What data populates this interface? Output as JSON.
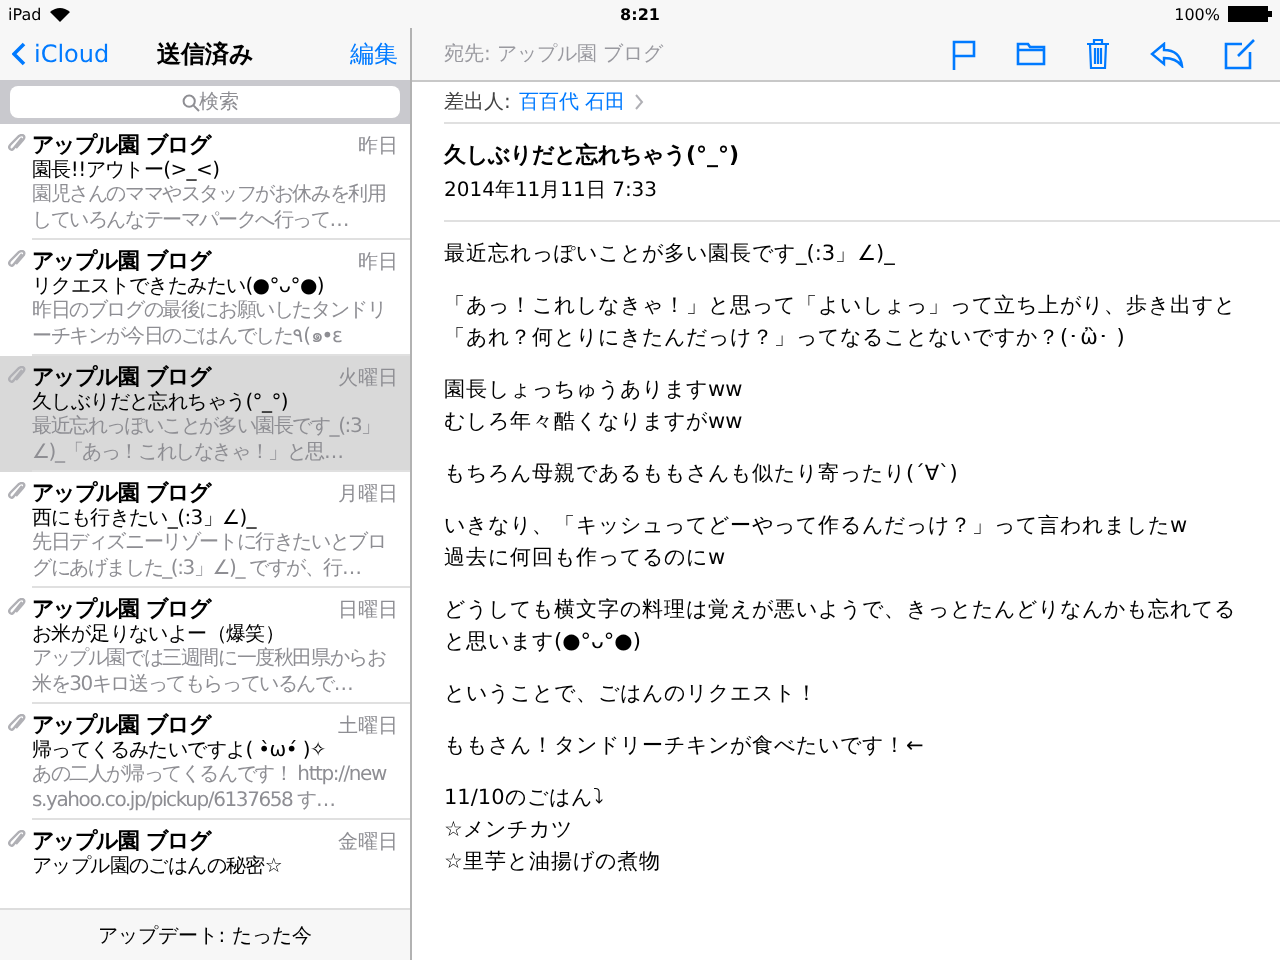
{
  "status_bar": {
    "device": "iPad",
    "time": "8:21",
    "battery": "100%"
  },
  "sidebar": {
    "back": "iCloud",
    "title": "送信済み",
    "edit": "編集",
    "search": {
      "placeholder": "検索"
    },
    "messages": [
      {
        "sender": "アップル園 ブログ",
        "date": "昨日",
        "subject": "園長!!アウトー(>_<)",
        "preview": "園児さんのママやスタッフがお休みを利用していろんなテーマパークへ行って…",
        "attachment": true,
        "selected": false
      },
      {
        "sender": "アップル園 ブログ",
        "date": "昨日",
        "subject": "リクエストできたみたい(●°ᴗ°●)",
        "preview": "昨日のブログの最後にお願いしたタンドリーチキンが今日のごはんでした٩(๑•ε",
        "attachment": true,
        "selected": false
      },
      {
        "sender": "アップル園 ブログ",
        "date": "火曜日",
        "subject": "久しぶりだと忘れちゃう(°_°)",
        "preview": "最近忘れっぽいことが多い園長です_(:3」∠)_「あっ！これしなきゃ！」と思…",
        "attachment": true,
        "selected": true
      },
      {
        "sender": "アップル園 ブログ",
        "date": "月曜日",
        "subject": "西にも行きたい_(:3」∠)_",
        "preview": "先日ディズニーリゾートに行きたいとブログにあげました_(:3」∠)_ ですが、行…",
        "attachment": true,
        "selected": false
      },
      {
        "sender": "アップル園 ブログ",
        "date": "日曜日",
        "subject": "お米が足りないよー（爆笑）",
        "preview": "アップル園では三週間に一度秋田県からお米を30キロ送ってもらっているんで…",
        "attachment": true,
        "selected": false
      },
      {
        "sender": "アップル園 ブログ",
        "date": "土曜日",
        "subject": "帰ってくるみたいですよ( •̀ω•́ )✧",
        "preview": "あの二人が帰ってくるんです！ http://news.yahoo.co.jp/pickup/6137658 す…",
        "attachment": true,
        "selected": false
      },
      {
        "sender": "アップル園 ブログ",
        "date": "金曜日",
        "subject": "アップル園のごはんの秘密☆",
        "attachment": true,
        "selected": false
      }
    ],
    "update_status": "アップデート: たった今"
  },
  "message": {
    "to": "宛先: アップル園 ブログ",
    "from_label": "差出人:",
    "from": "百百代 石田",
    "subject": "久しぶりだと忘れちゃう(°_°)",
    "date": "2014年11月11日 7:33",
    "body": [
      [
        "最近忘れっぽいことが多い園長です_(:3」∠)_"
      ],
      [
        "「あっ！これしなきゃ！」と思って「よいしょっ」って立ち上がり、歩き出すと「あれ？何とりにきたんだっけ？」ってなることないですか？(･ὢ･ )"
      ],
      [
        "園長しょっちゅうありますww",
        "むしろ年々酷くなりますがww"
      ],
      [
        "もちろん母親であるももさんも似たり寄ったり(´∀`)"
      ],
      [
        "いきなり、「キッシュってどーやって作るんだっけ？」って言われましたw",
        "過去に何回も作ってるのにw"
      ],
      [
        "どうしても横文字の料理は覚えが悪いようで、きっとたんどりなんかも忘れてると思います(●°ᴗ°●)"
      ],
      [
        "ということで、ごはんのリクエスト！"
      ],
      [
        "ももさん！タンドリーチキンが食べたいです！←"
      ],
      [
        "11/10のごはん⤵",
        "☆メンチカツ",
        "☆里芋と油揚げの煮物"
      ]
    ]
  }
}
